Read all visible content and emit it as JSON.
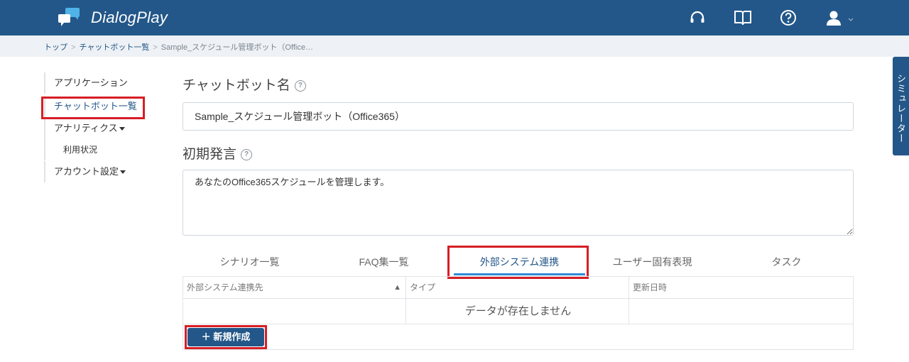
{
  "header": {
    "brand": "DialogPlay",
    "icons": [
      "headset-icon",
      "book-icon",
      "help-circle-icon",
      "user-icon",
      "chevron-down-icon"
    ],
    "bg_color": "#235789"
  },
  "breadcrumb": {
    "items": [
      "トップ",
      "チャットボット一覧"
    ],
    "current": "Sample_スケジュール管理ボット（Office…",
    "separator": ">"
  },
  "sidebar": {
    "items": [
      {
        "label": "アプリケーション"
      },
      {
        "label": "チャットボット一覧"
      },
      {
        "label": "アナリティクス"
      },
      {
        "label": "利用状況"
      },
      {
        "label": "アカウント設定"
      }
    ]
  },
  "form": {
    "name_label": "チャットボット名",
    "name_value": "Sample_スケジュール管理ボット（Office365）",
    "greeting_label": "初期発言",
    "greeting_value": "あなたのOffice365スケジュールを管理します。",
    "help_glyph": "?"
  },
  "tabs": [
    {
      "label": "シナリオ一覧"
    },
    {
      "label": "FAQ集一覧"
    },
    {
      "label": "外部システム連携",
      "active": true
    },
    {
      "label": "ユーザー固有表現"
    },
    {
      "label": "タスク"
    }
  ],
  "table": {
    "columns": [
      "外部システム連携先",
      "タイプ",
      "更新日時"
    ],
    "sort_indicator": "▲",
    "empty_message": "データが存在しません"
  },
  "new_button": {
    "plus": "＋",
    "label": "新規作成"
  },
  "simulator_tab": {
    "label": "シミュレーター"
  },
  "colors": {
    "accent": "#235789",
    "highlight": "#d61e25",
    "tab_underline": "#2e8bd6"
  }
}
